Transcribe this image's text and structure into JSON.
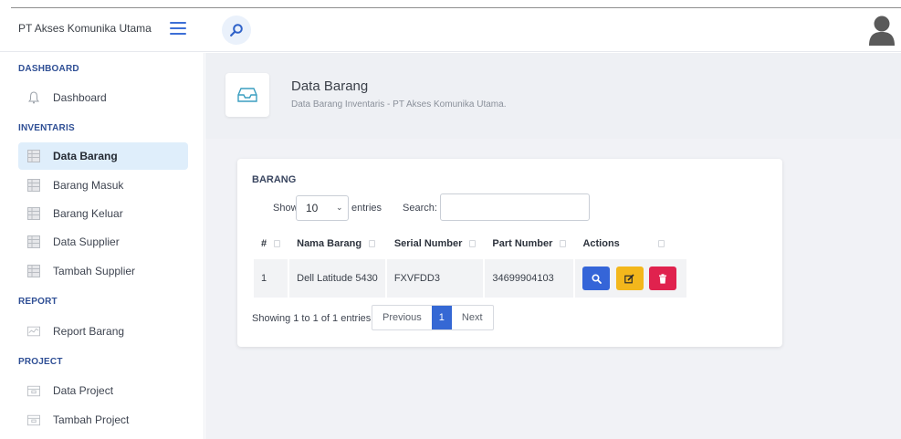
{
  "header": {
    "brand": "PT Akses Komunika Utama",
    "menu_icon": "hamburger-icon",
    "search_icon": "search-icon",
    "avatar_icon": "user-avatar-icon"
  },
  "sidebar": {
    "sections": {
      "dashboard": "DASHBOARD",
      "inventaris": "INVENTARIS",
      "report": "REPORT",
      "project": "PROJECT"
    },
    "items": [
      {
        "label": "Dashboard",
        "icon": "bell-icon"
      },
      {
        "label": "Data Barang",
        "icon": "table-icon",
        "active": true
      },
      {
        "label": "Barang Masuk",
        "icon": "table-icon"
      },
      {
        "label": "Barang Keluar",
        "icon": "table-icon"
      },
      {
        "label": "Data Supplier",
        "icon": "table-icon"
      },
      {
        "label": "Tambah Supplier",
        "icon": "table-icon"
      },
      {
        "label": "Report Barang",
        "icon": "report-icon"
      },
      {
        "label": "Data Project",
        "icon": "folder-icon"
      },
      {
        "label": "Tambah Project",
        "icon": "folder-icon"
      }
    ]
  },
  "page": {
    "title": "Data Barang",
    "subtitle": "Data Barang Inventaris - PT Akses Komunika Utama.",
    "title_icon": "inbox-icon"
  },
  "card": {
    "title": "BARANG",
    "show_label": "Show",
    "entries_value": "10",
    "entries_label": "entries",
    "search_label": "Search:",
    "search_value": "",
    "columns": [
      "#",
      "Nama Barang",
      "Serial Number",
      "Part Number",
      "Actions"
    ],
    "rows": [
      {
        "no": "1",
        "nama": "Dell Latitude 5430",
        "serial": "FXVFDD3",
        "part": "34699904103"
      }
    ],
    "actions": [
      {
        "name": "view",
        "icon": "search-icon",
        "color": "#3565d8"
      },
      {
        "name": "edit",
        "icon": "edit-icon",
        "color": "#f3b71c"
      },
      {
        "name": "delete",
        "icon": "trash-icon",
        "color": "#e0224e"
      }
    ],
    "showing": "Showing 1 to 1 of 1 entries",
    "pagination": {
      "previous": "Previous",
      "current": "1",
      "next": "Next"
    }
  },
  "colors": {
    "accent": "#3568d4",
    "active_bg": "#dfeefb",
    "section": "#2f4f95"
  }
}
